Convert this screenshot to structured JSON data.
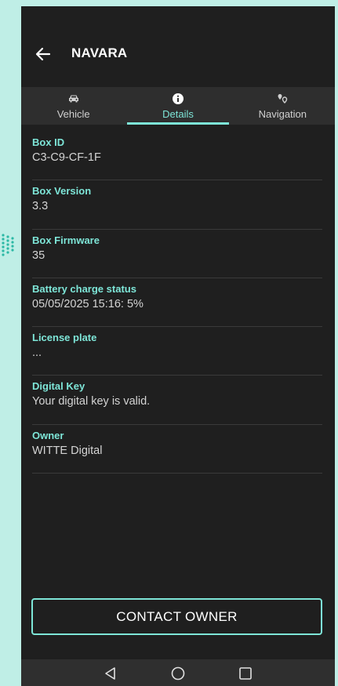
{
  "app": {
    "title": "NAVARA"
  },
  "icons": {
    "back": "arrow-left-icon",
    "vehicle": "car-icon",
    "details": "info-icon",
    "navigation": "map-pins-icon",
    "nav_back": "triangle-back-icon",
    "nav_home": "circle-home-icon",
    "nav_recent": "square-recent-icon"
  },
  "tabs": [
    {
      "label": "Vehicle",
      "active": false
    },
    {
      "label": "Details",
      "active": true
    },
    {
      "label": "Navigation",
      "active": false
    }
  ],
  "details": [
    {
      "label": "Box ID",
      "value": "C3-C9-CF-1F"
    },
    {
      "label": "Box Version",
      "value": "3.3"
    },
    {
      "label": "Box Firmware",
      "value": "35"
    },
    {
      "label": "Battery charge status",
      "value": "05/05/2025 15:16: 5%"
    },
    {
      "label": "License plate",
      "value": "..."
    },
    {
      "label": "Digital Key",
      "value": "Your digital key is valid."
    },
    {
      "label": "Owner",
      "value": "WITTE Digital"
    }
  ],
  "actions": {
    "contact_owner": "CONTACT OWNER"
  },
  "colors": {
    "accent": "#7ee6d8",
    "background": "#1f1f1f",
    "tab_bar": "#2e2e2e",
    "outer": "#bfeee6"
  }
}
